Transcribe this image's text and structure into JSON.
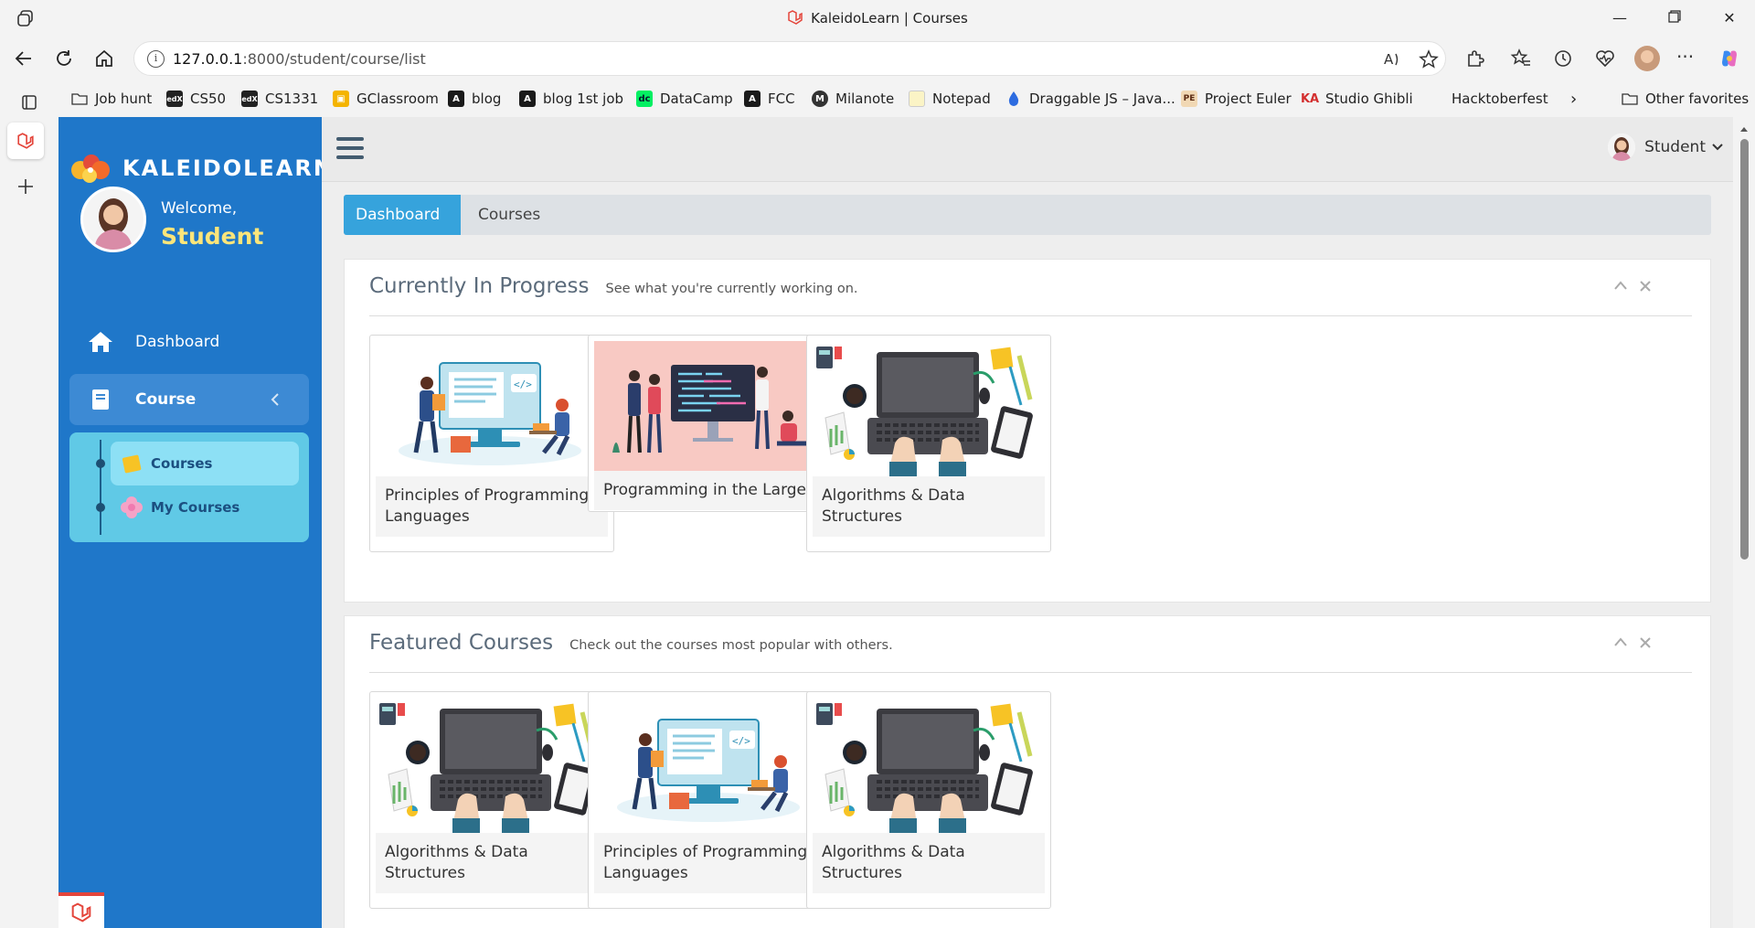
{
  "browser": {
    "window_title": "KaleidoLearn | Courses",
    "url_host": "127.0.0.1",
    "url_rest": ":8000/student/course/list",
    "favorites": [
      {
        "label": "Job hunt",
        "icon": "folder-icon"
      },
      {
        "label": "CS50",
        "icon": "edx-icon"
      },
      {
        "label": "CS1331",
        "icon": "edx-icon"
      },
      {
        "label": "GClassroom",
        "icon": "google-classroom-icon"
      },
      {
        "label": "blog",
        "icon": "blog-icon"
      },
      {
        "label": "blog 1st job",
        "icon": "blog-icon"
      },
      {
        "label": "DataCamp",
        "icon": "datacamp-icon"
      },
      {
        "label": "FCC",
        "icon": "freecodecamp-icon"
      },
      {
        "label": "Milanote",
        "icon": "milanote-icon"
      },
      {
        "label": "Notepad",
        "icon": "notepad-icon"
      },
      {
        "label": "Draggable JS – Java...",
        "icon": "droplet-icon"
      },
      {
        "label": "Project Euler",
        "icon": "project-euler-icon"
      },
      {
        "label": "Studio Ghibli",
        "icon": "khan-academy-icon"
      },
      {
        "label": "Hacktoberfest",
        "icon": "hacktoberfest-icon"
      }
    ],
    "other_favorites": "Other favorites"
  },
  "sidebar": {
    "brand": "KALEIDOLEARN",
    "welcome": "Welcome,",
    "username": "Student",
    "dashboard": "Dashboard",
    "course": "Course",
    "sub_items": [
      "Courses",
      "My Courses"
    ]
  },
  "topnav": {
    "user_label": "Student"
  },
  "breadcrumb": {
    "active": "Dashboard",
    "current": "Courses"
  },
  "in_progress": {
    "title": "Currently In Progress",
    "subtitle": "See what you're currently working on.",
    "cards": [
      {
        "title": "Principles of Programming Languages",
        "image": "developer-at-computer-illustration"
      },
      {
        "title": "Programming in the Large",
        "image": "team-coding-illustration"
      },
      {
        "title": "Algorithms & Data Structures",
        "image": "laptop-desk-illustration"
      }
    ]
  },
  "featured": {
    "title": "Featured Courses",
    "subtitle": "Check out the courses most popular with others.",
    "cards": [
      {
        "title": "Algorithms & Data Structures",
        "image": "laptop-desk-illustration"
      },
      {
        "title": "Principles of Programming Languages",
        "image": "developer-at-computer-illustration"
      },
      {
        "title": "Algorithms & Data Structures",
        "image": "laptop-desk-illustration"
      }
    ]
  },
  "colors": {
    "sidebar": "#1f77c9",
    "accent": "#36a3dc",
    "username": "#fce57a",
    "submenu": "#60c9e6"
  }
}
